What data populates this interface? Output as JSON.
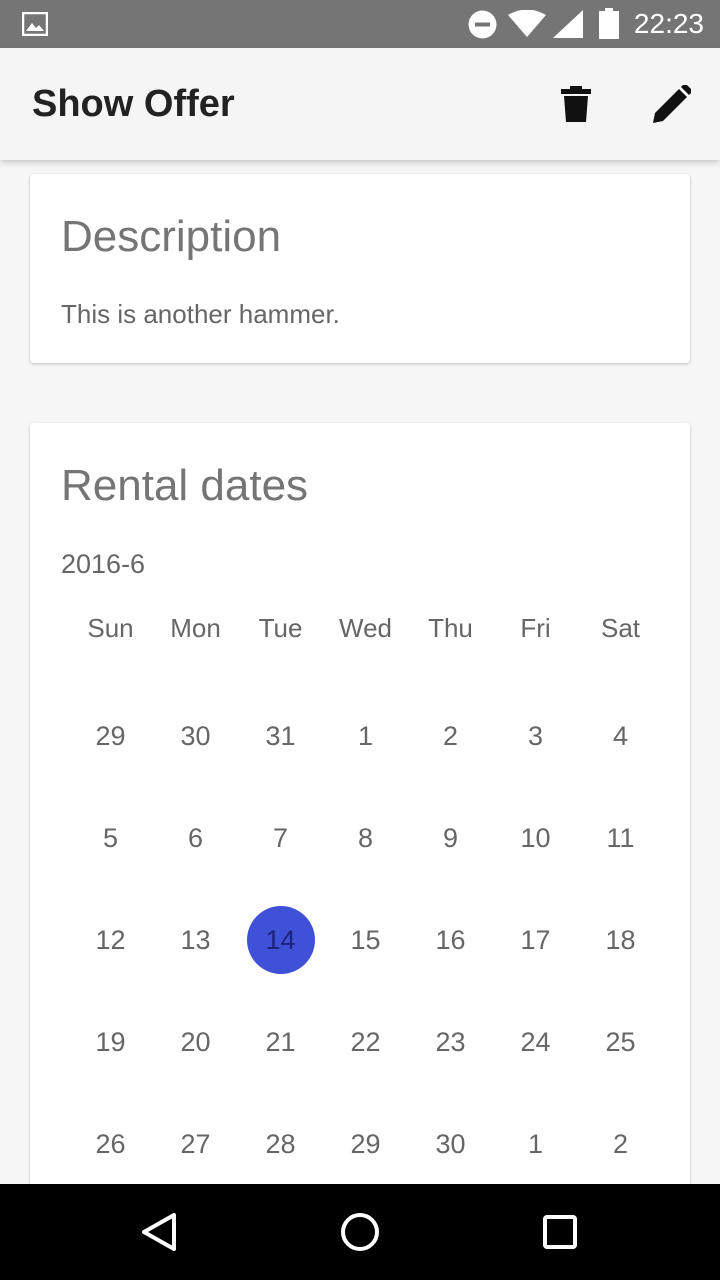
{
  "status_bar": {
    "time": "22:23",
    "icons": [
      "gallery-icon",
      "do-not-disturb-icon",
      "wifi-icon",
      "cell-signal-icon",
      "battery-icon"
    ]
  },
  "app_bar": {
    "title": "Show Offer",
    "actions": [
      "delete-icon",
      "edit-icon"
    ]
  },
  "description_card": {
    "title": "Description",
    "text": "This is another hammer."
  },
  "rental_card": {
    "title": "Rental dates",
    "month": "2016-6",
    "weekdays": [
      "Sun",
      "Mon",
      "Tue",
      "Wed",
      "Thu",
      "Fri",
      "Sat"
    ],
    "weeks": [
      [
        "29",
        "30",
        "31",
        "1",
        "2",
        "3",
        "4"
      ],
      [
        "5",
        "6",
        "7",
        "8",
        "9",
        "10",
        "11"
      ],
      [
        "12",
        "13",
        "14",
        "15",
        "16",
        "17",
        "18"
      ],
      [
        "19",
        "20",
        "21",
        "22",
        "23",
        "24",
        "25"
      ],
      [
        "26",
        "27",
        "28",
        "29",
        "30",
        "1",
        "2"
      ]
    ],
    "selected_day": "14",
    "selected_color": "#3f51d6"
  },
  "nav_bar": {
    "buttons": [
      "back-icon",
      "home-icon",
      "recents-icon"
    ]
  }
}
